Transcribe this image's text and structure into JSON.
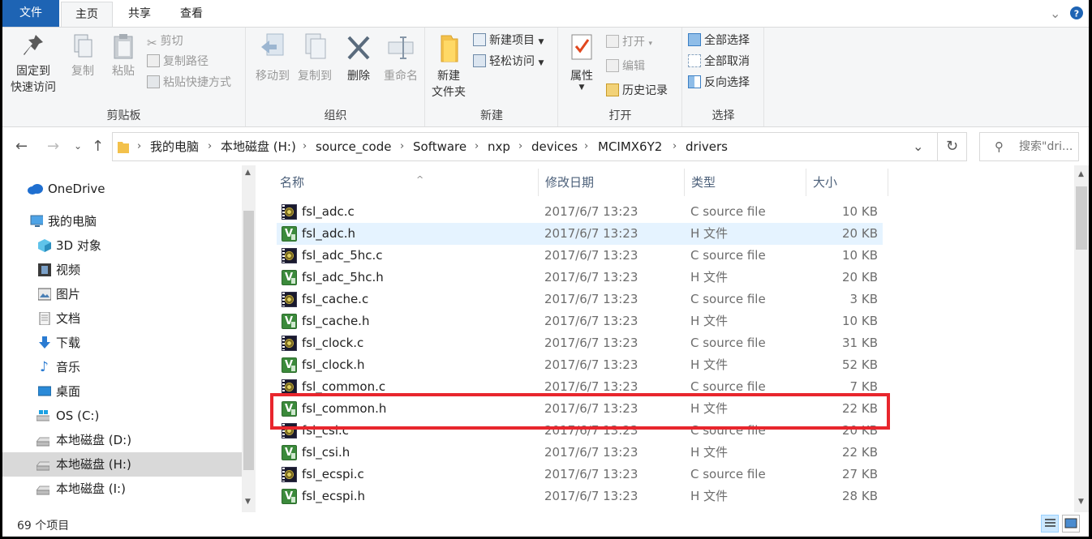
{
  "ribbon_tabs": {
    "file": "文件",
    "home": "主页",
    "share": "共享",
    "view": "查看"
  },
  "clipboard": {
    "pin": "固定到\n快速访问",
    "copy": "复制",
    "paste": "粘贴",
    "cut": "剪切",
    "copy_path": "复制路径",
    "paste_shortcut": "粘贴快捷方式",
    "label": "剪贴板"
  },
  "organize": {
    "move_to": "移动到",
    "copy_to": "复制到",
    "delete": "删除",
    "rename": "重命名",
    "label": "组织"
  },
  "new": {
    "new_folder": "新建\n文件夹",
    "new_item": "新建项目",
    "easy_access": "轻松访问",
    "label": "新建"
  },
  "open": {
    "properties": "属性",
    "open": "打开",
    "edit": "编辑",
    "history": "历史记录",
    "label": "打开"
  },
  "select": {
    "select_all": "全部选择",
    "select_none": "全部取消",
    "invert": "反向选择",
    "label": "选择"
  },
  "breadcrumb": [
    "我的电脑",
    "本地磁盘 (H:)",
    "source_code",
    "Software",
    "nxp",
    "devices",
    "MCIMX6Y2",
    "drivers"
  ],
  "search": {
    "placeholder": "搜索\"dri..."
  },
  "nav": {
    "onedrive": "OneDrive",
    "this_pc": "我的电脑",
    "items": [
      "3D 对象",
      "视频",
      "图片",
      "文档",
      "下载",
      "音乐",
      "桌面",
      "OS (C:)",
      "本地磁盘 (D:)",
      "本地磁盘 (H:)",
      "本地磁盘 (I:)"
    ],
    "selected": "本地磁盘 (H:)"
  },
  "columns": {
    "name": "名称",
    "date": "修改日期",
    "type": "类型",
    "size": "大小"
  },
  "files": [
    {
      "name": "fsl_adc.c",
      "date": "2017/6/7 13:23",
      "type": "C source file",
      "size": "10 KB",
      "kind": "c"
    },
    {
      "name": "fsl_adc.h",
      "date": "2017/6/7 13:23",
      "type": "H 文件",
      "size": "20 KB",
      "kind": "h"
    },
    {
      "name": "fsl_adc_5hc.c",
      "date": "2017/6/7 13:23",
      "type": "C source file",
      "size": "10 KB",
      "kind": "c"
    },
    {
      "name": "fsl_adc_5hc.h",
      "date": "2017/6/7 13:23",
      "type": "H 文件",
      "size": "20 KB",
      "kind": "h"
    },
    {
      "name": "fsl_cache.c",
      "date": "2017/6/7 13:23",
      "type": "C source file",
      "size": "3 KB",
      "kind": "c"
    },
    {
      "name": "fsl_cache.h",
      "date": "2017/6/7 13:23",
      "type": "H 文件",
      "size": "10 KB",
      "kind": "h"
    },
    {
      "name": "fsl_clock.c",
      "date": "2017/6/7 13:23",
      "type": "C source file",
      "size": "31 KB",
      "kind": "c"
    },
    {
      "name": "fsl_clock.h",
      "date": "2017/6/7 13:23",
      "type": "H 文件",
      "size": "52 KB",
      "kind": "h"
    },
    {
      "name": "fsl_common.c",
      "date": "2017/6/7 13:23",
      "type": "C source file",
      "size": "7 KB",
      "kind": "c"
    },
    {
      "name": "fsl_common.h",
      "date": "2017/6/7 13:23",
      "type": "H 文件",
      "size": "22 KB",
      "kind": "h"
    },
    {
      "name": "fsl_csi.c",
      "date": "2017/6/7 13:23",
      "type": "C source file",
      "size": "20 KB",
      "kind": "c"
    },
    {
      "name": "fsl_csi.h",
      "date": "2017/6/7 13:23",
      "type": "H 文件",
      "size": "22 KB",
      "kind": "h"
    },
    {
      "name": "fsl_ecspi.c",
      "date": "2017/6/7 13:23",
      "type": "C source file",
      "size": "27 KB",
      "kind": "c"
    },
    {
      "name": "fsl_ecspi.h",
      "date": "2017/6/7 13:23",
      "type": "H 文件",
      "size": "28 KB",
      "kind": "h"
    }
  ],
  "status": {
    "count": "69 个项目"
  },
  "colors": {
    "accent": "#1e64b4",
    "highlight_box": "#e8262d",
    "hover_row": "#e5f3ff"
  }
}
